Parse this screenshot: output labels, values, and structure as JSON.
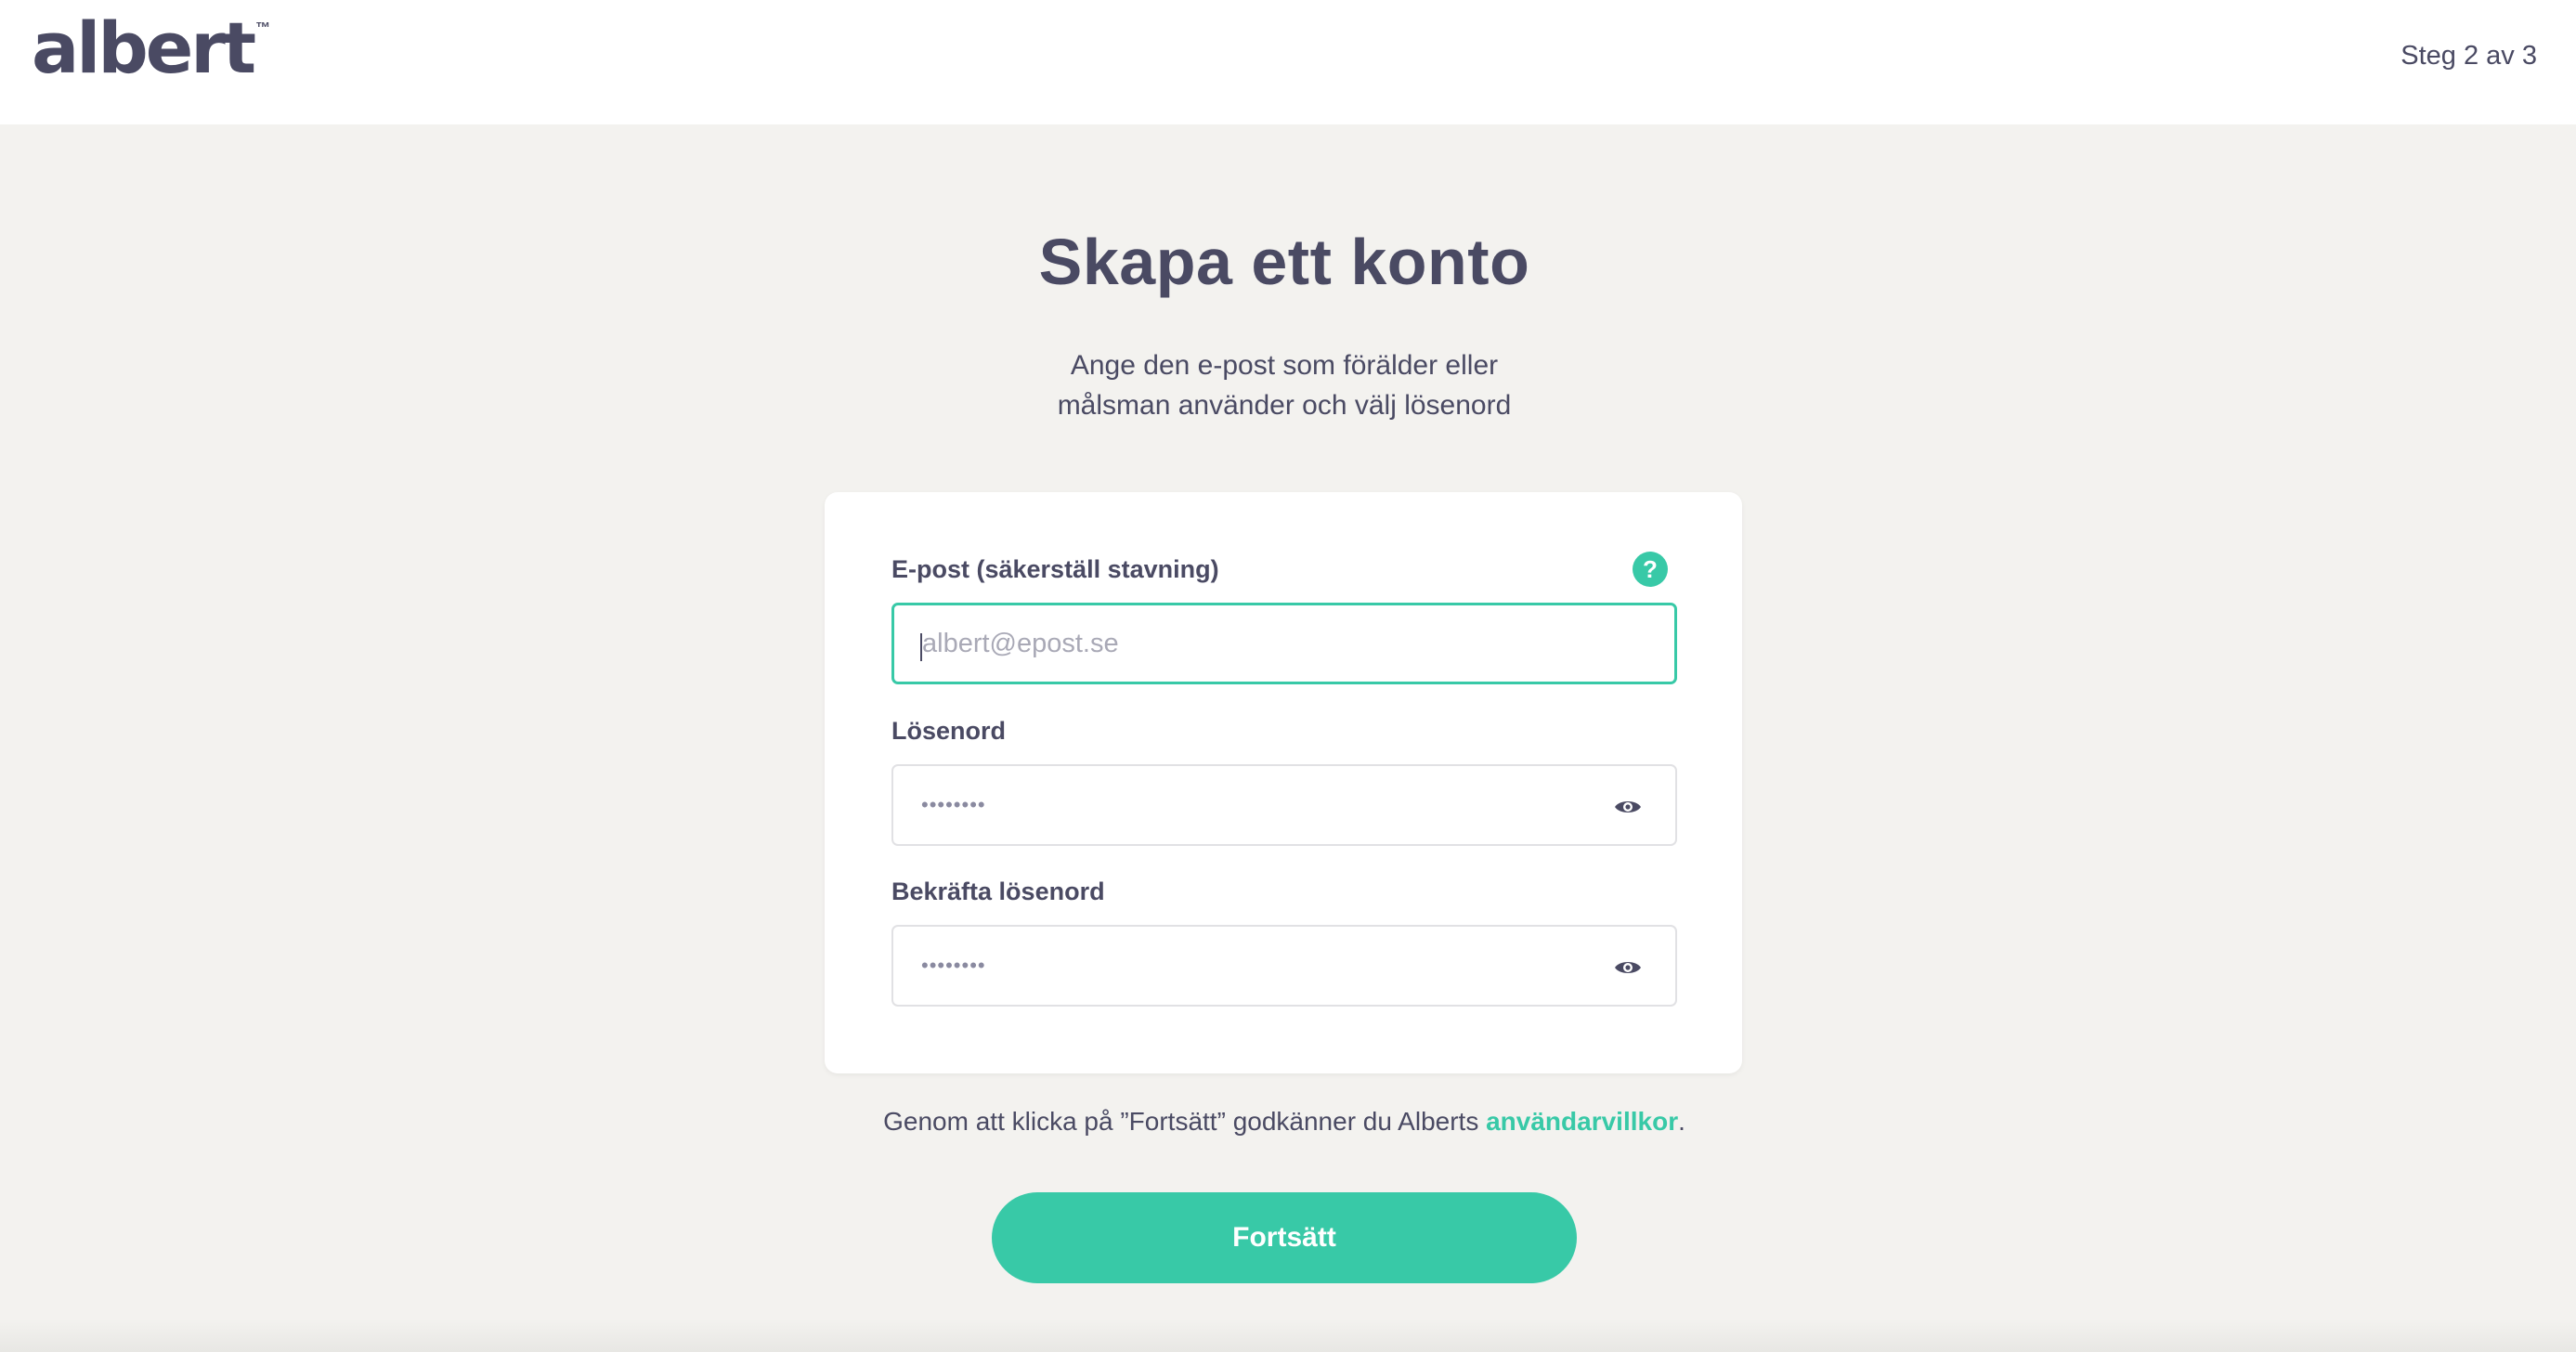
{
  "header": {
    "logo_text": "albert",
    "logo_tm": "™",
    "step": "Steg 2 av 3"
  },
  "main": {
    "title": "Skapa ett konto",
    "subtitle_line1": "Ange den e-post som förälder eller",
    "subtitle_line2": "målsman använder och välj lösenord"
  },
  "form": {
    "email_label": "E-post (säkerställ stavning)",
    "email_placeholder": "albert@epost.se",
    "email_value": "",
    "help_icon": "?",
    "password_label": "Lösenord",
    "password_mask": "••••••••",
    "confirm_label": "Bekräfta lösenord",
    "confirm_mask": "••••••••"
  },
  "terms": {
    "prefix": "Genom att klicka på ”Fortsätt” godkänner du Alberts ",
    "link": "användarvillkor",
    "suffix": "."
  },
  "actions": {
    "continue_label": "Fortsätt"
  },
  "icons": {
    "help": "question-mark-icon",
    "password_toggle": "eye-icon"
  },
  "colors": {
    "accent": "#38c9a7",
    "text": "#4a4a63",
    "background": "#f3f2ef"
  }
}
